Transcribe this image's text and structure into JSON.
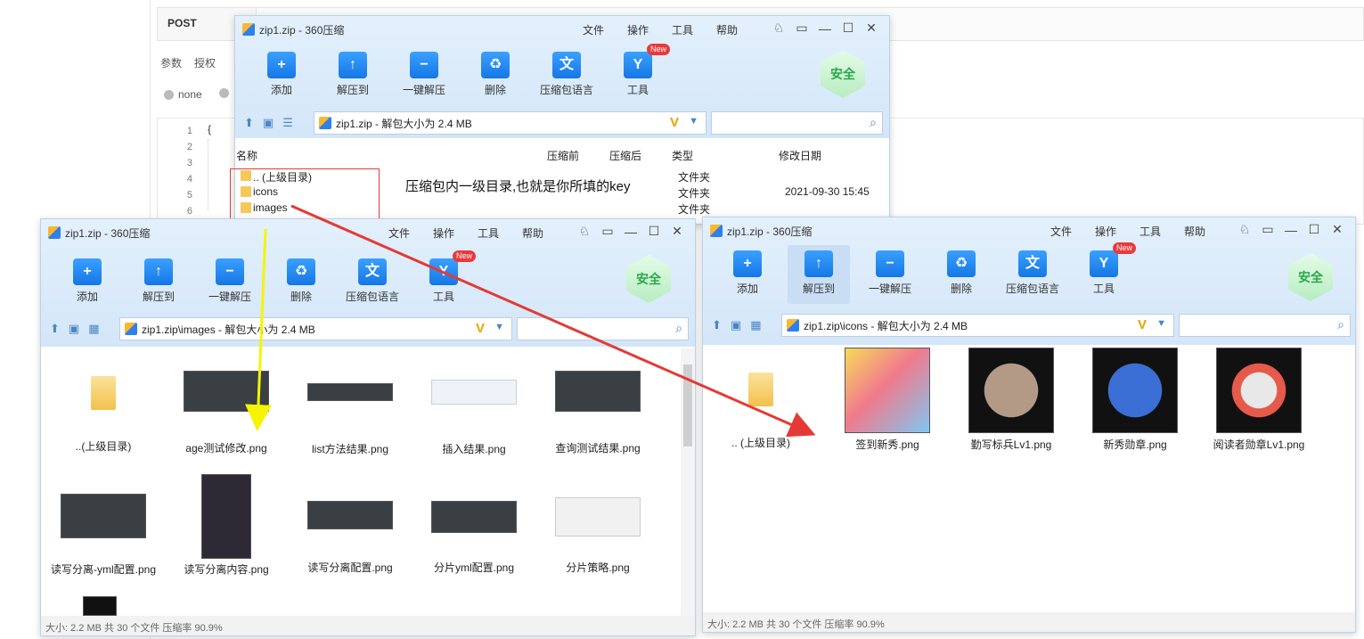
{
  "background": {
    "method": "POST",
    "tabs": [
      "参数",
      "授权"
    ],
    "radio_label": "none",
    "line_numbers": [
      "1",
      "2",
      "3",
      "4",
      "5",
      "6"
    ],
    "first_line": "{"
  },
  "common": {
    "menu": [
      "文件",
      "操作",
      "工具",
      "帮助"
    ],
    "toolbar": [
      "添加",
      "解压到",
      "一键解压",
      "删除",
      "压缩包语言",
      "工具"
    ],
    "new_badge": "New",
    "safe": "安全"
  },
  "win_top": {
    "title": "zip1.zip - 360压缩",
    "path": "zip1.zip - 解包大小为 2.4 MB",
    "columns": [
      "名称",
      "压缩前",
      "压缩后",
      "类型",
      "修改日期"
    ],
    "rows": [
      {
        "name": ".. (上级目录)",
        "type": "文件夹",
        "date": ""
      },
      {
        "name": "icons",
        "type": "文件夹",
        "date": "2021-09-30 15:45"
      },
      {
        "name": "images",
        "type": "文件夹",
        "date": ""
      }
    ]
  },
  "annotation": "压缩包内一级目录,也就是你所填的key",
  "win_left": {
    "title": "zip1.zip - 360压缩",
    "path": "zip1.zip\\images - 解包大小为 2.4 MB",
    "items": [
      "..(上级目录)",
      "age测试修改.png",
      "list方法结果.png",
      "插入结果.png",
      "查询测试结果.png",
      "读写分离-yml配置.png",
      "读写分离内容.png",
      "读写分离配置.png",
      "分片yml配置.png",
      "分片策略.png"
    ],
    "status": "大小: 2.2 MB 共 30 个文件 压缩率 90.9%"
  },
  "win_right": {
    "title": "zip1.zip - 360压缩",
    "path": "zip1.zip\\icons - 解包大小为 2.4 MB",
    "items": [
      ".. (上级目录)",
      "签到新秀.png",
      "勤写标兵Lv1.png",
      "新秀勋章.png",
      "阅读者勋章Lv1.png"
    ],
    "status": "大小: 2.2 MB 共 30 个文件 压缩率 90.9%"
  },
  "colors": {
    "accent": "#1577e5",
    "arrow_red": "#e53935",
    "arrow_yellow": "#f5f500"
  }
}
